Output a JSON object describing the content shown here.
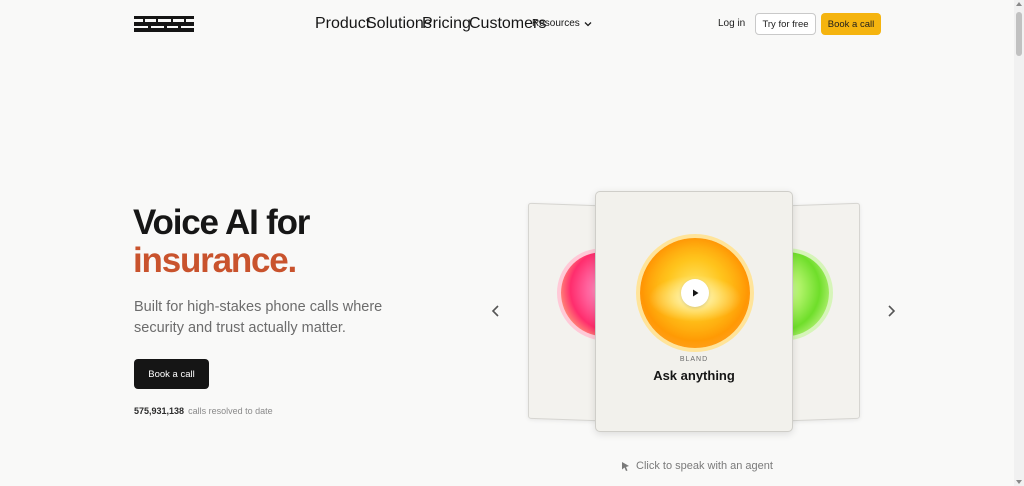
{
  "brand": {
    "logo_alt": "bland"
  },
  "nav": {
    "items": [
      {
        "label": "Product"
      },
      {
        "label": "Solutions"
      },
      {
        "label": "Pricing"
      },
      {
        "label": "Customers"
      },
      {
        "label": "Resources"
      }
    ],
    "login": "Log in",
    "try_free": "Try for free",
    "book_call": "Book a call"
  },
  "hero": {
    "headline_line1": "Voice AI for",
    "headline_line2": "insurance.",
    "subtitle": "Built for high-stakes phone calls where security and trust actually matter.",
    "cta": "Book a call",
    "calls_count": "575,931,138",
    "calls_label": "calls resolved to date"
  },
  "carousel": {
    "active_card": {
      "brand": "BLAND",
      "title": "Ask anything"
    },
    "hint": "Click to speak with an agent"
  },
  "colors": {
    "accent": "#f5b40f",
    "headline_accent": "#c9532d",
    "dark_button": "#151515"
  }
}
